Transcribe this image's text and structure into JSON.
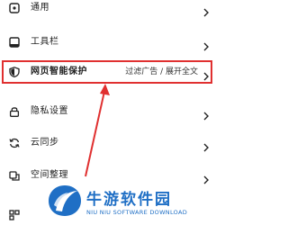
{
  "menu": {
    "items": [
      {
        "label": "通用",
        "icon": "general-settings-icon"
      },
      {
        "label": "工具栏",
        "icon": "toolbar-icon"
      },
      {
        "label": "网页智能保护",
        "icon": "shield-icon",
        "detail": "过滤广告 / 展开全文",
        "highlighted": true
      },
      {
        "label": "隐私设置",
        "icon": "lock-icon"
      },
      {
        "label": "云同步",
        "icon": "sync-icon"
      },
      {
        "label": "空间整理",
        "icon": "storage-icon"
      }
    ]
  },
  "annotation": {
    "color": "#e03030"
  },
  "watermark": {
    "title": "牛游软件园",
    "subtitle": "NIU NIU SOFTWARE DOWNLOAD",
    "color": "#1f6fc5"
  }
}
